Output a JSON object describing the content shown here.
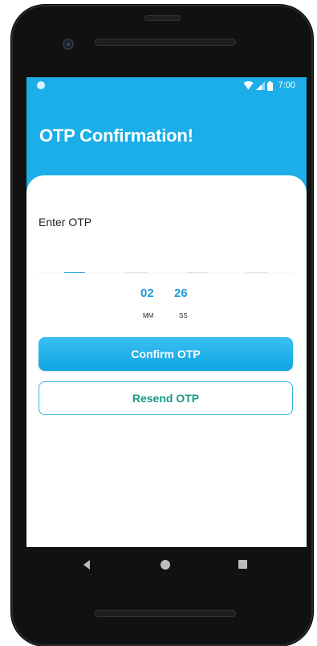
{
  "status_bar": {
    "time": "7:00"
  },
  "header": {
    "title": "OTP Confirmation!"
  },
  "form": {
    "label": "Enter OTP",
    "otp_digits": [
      "",
      "",
      "",
      ""
    ]
  },
  "timer": {
    "minutes": "02",
    "seconds": "26",
    "minutes_unit": "MM",
    "seconds_unit": "SS"
  },
  "buttons": {
    "confirm_label": "Confirm OTP",
    "resend_label": "Resend OTP"
  },
  "colors": {
    "primary": "#1baee8",
    "timer": "#1e9bd6",
    "resend_text": "#1a9986"
  }
}
